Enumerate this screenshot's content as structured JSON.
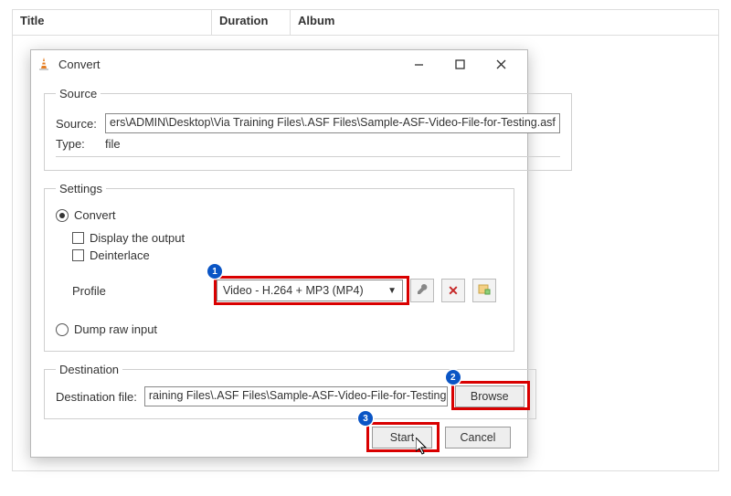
{
  "background": {
    "columns": [
      "Title",
      "Duration",
      "Album"
    ]
  },
  "dialog": {
    "title": "Convert",
    "source_section": {
      "legend": "Source",
      "source_label": "Source:",
      "source_value": "ers\\ADMIN\\Desktop\\Via Training Files\\.ASF Files\\Sample-ASF-Video-File-for-Testing.asf",
      "type_label": "Type:",
      "type_value": "file"
    },
    "settings_section": {
      "legend": "Settings",
      "convert_radio": "Convert",
      "display_output_check": "Display the output",
      "deinterlace_check": "Deinterlace",
      "profile_label": "Profile",
      "profile_value": "Video - H.264 + MP3 (MP4)",
      "dump_raw_radio": "Dump raw input"
    },
    "destination_section": {
      "legend": "Destination",
      "dest_label": "Destination file:",
      "dest_value": "raining Files\\.ASF Files\\Sample-ASF-Video-File-for-Testing.asf",
      "browse_btn": "Browse"
    },
    "footer": {
      "start_btn": "Start",
      "cancel_btn": "Cancel"
    }
  },
  "annotations": {
    "badge1": "1",
    "badge2": "2",
    "badge3": "3"
  }
}
